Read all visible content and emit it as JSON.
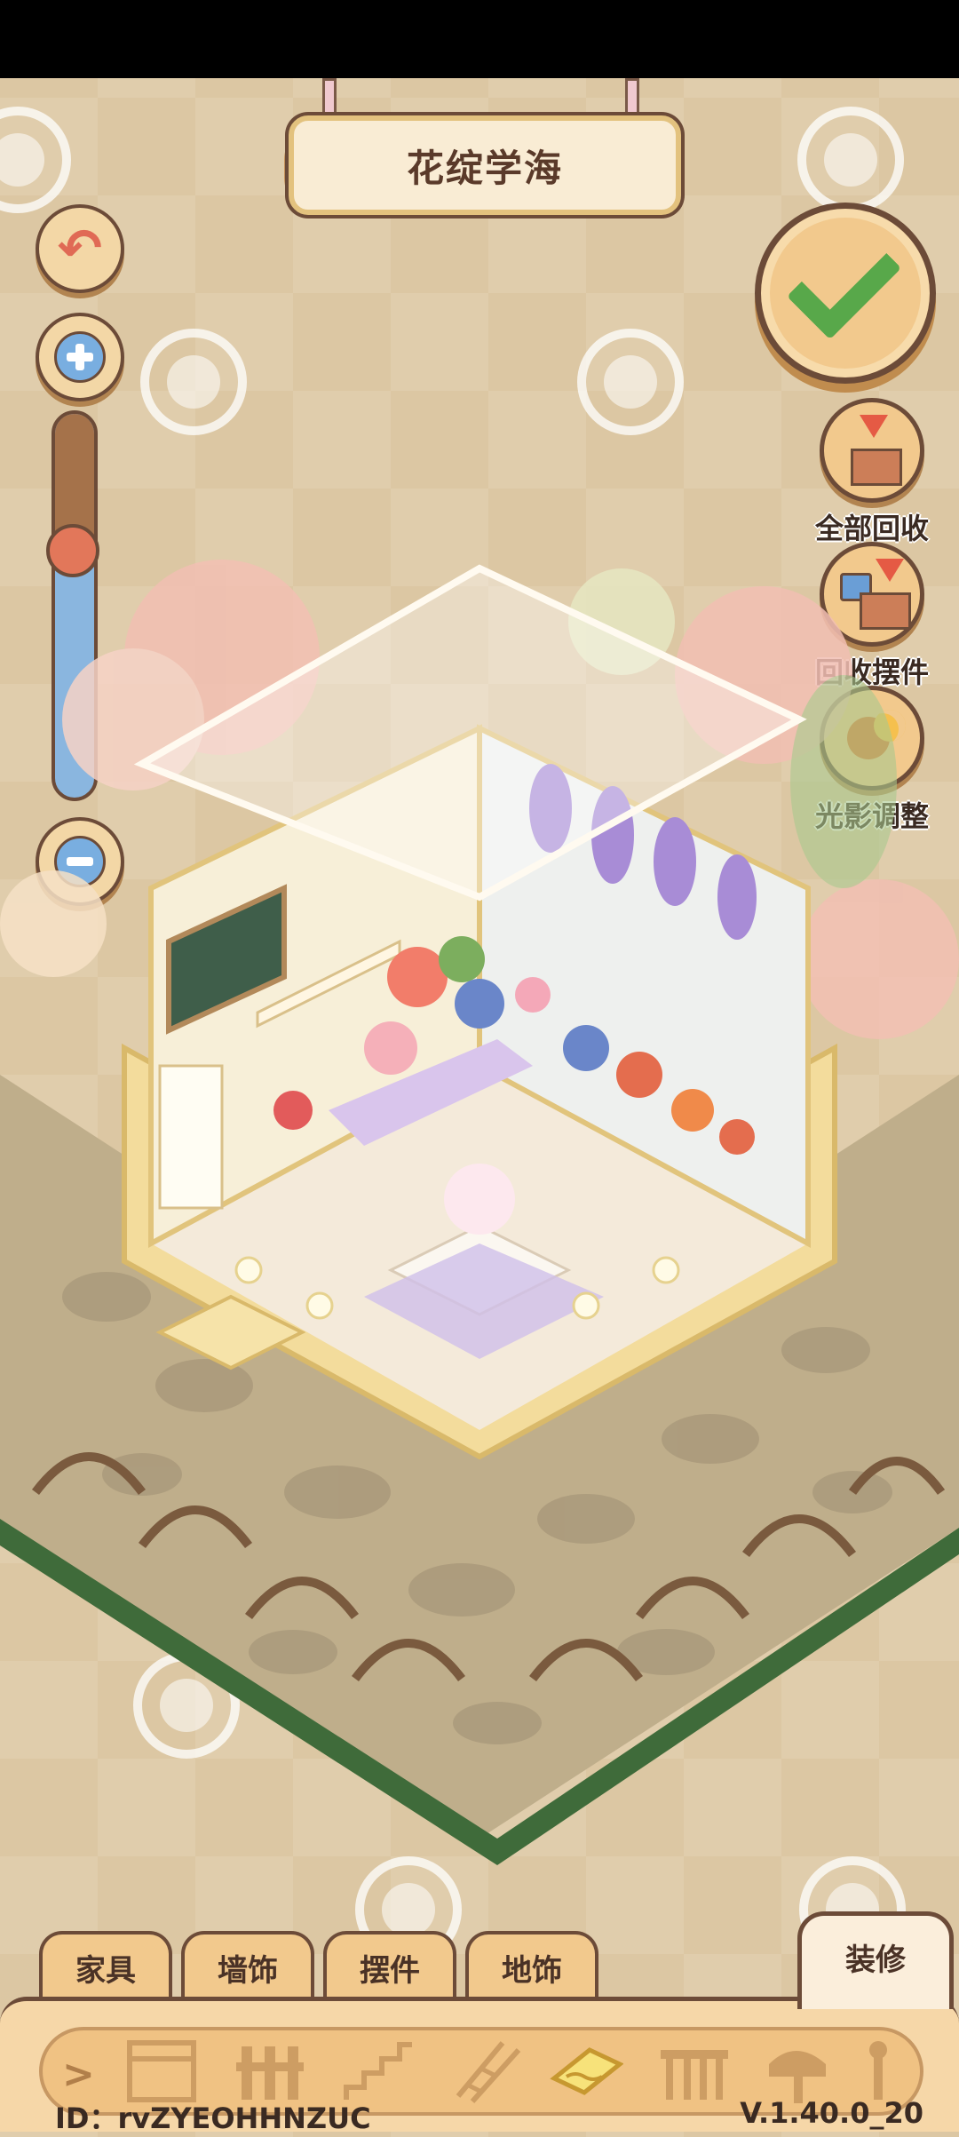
{
  "room": {
    "title": "花绽学海"
  },
  "controls": {
    "undo_icon": "undo-arrow-icon",
    "zoom_in_icon": "plus-icon",
    "zoom_out_icon": "minus-icon",
    "confirm_icon": "checkmark-icon",
    "zoom_level": 0.36
  },
  "side_actions": [
    {
      "label": "全部回收",
      "icon": "recycle-all-icon"
    },
    {
      "label": "回收摆件",
      "icon": "recycle-ornament-icon"
    },
    {
      "label": "光影调整",
      "icon": "lighting-icon"
    }
  ],
  "tabs": [
    {
      "label": "家具"
    },
    {
      "label": "墙饰"
    },
    {
      "label": "摆件"
    },
    {
      "label": "地饰"
    },
    {
      "label": "装修",
      "active": true
    }
  ],
  "category_icons": [
    "window-icon",
    "fence-icon",
    "stairs-icon",
    "ladder-icon",
    "floor-tile-icon",
    "railing-icon",
    "mailbox-icon",
    "lamp-icon"
  ],
  "footer": {
    "id_text": "ID：rvZYEOHHNZUC",
    "version_text": "V.1.40.0_20"
  },
  "colors": {
    "accent_green": "#58a84a",
    "panel": "#f6d7a8",
    "outline": "#6c4b38",
    "slider_blue": "#8ab6df"
  }
}
